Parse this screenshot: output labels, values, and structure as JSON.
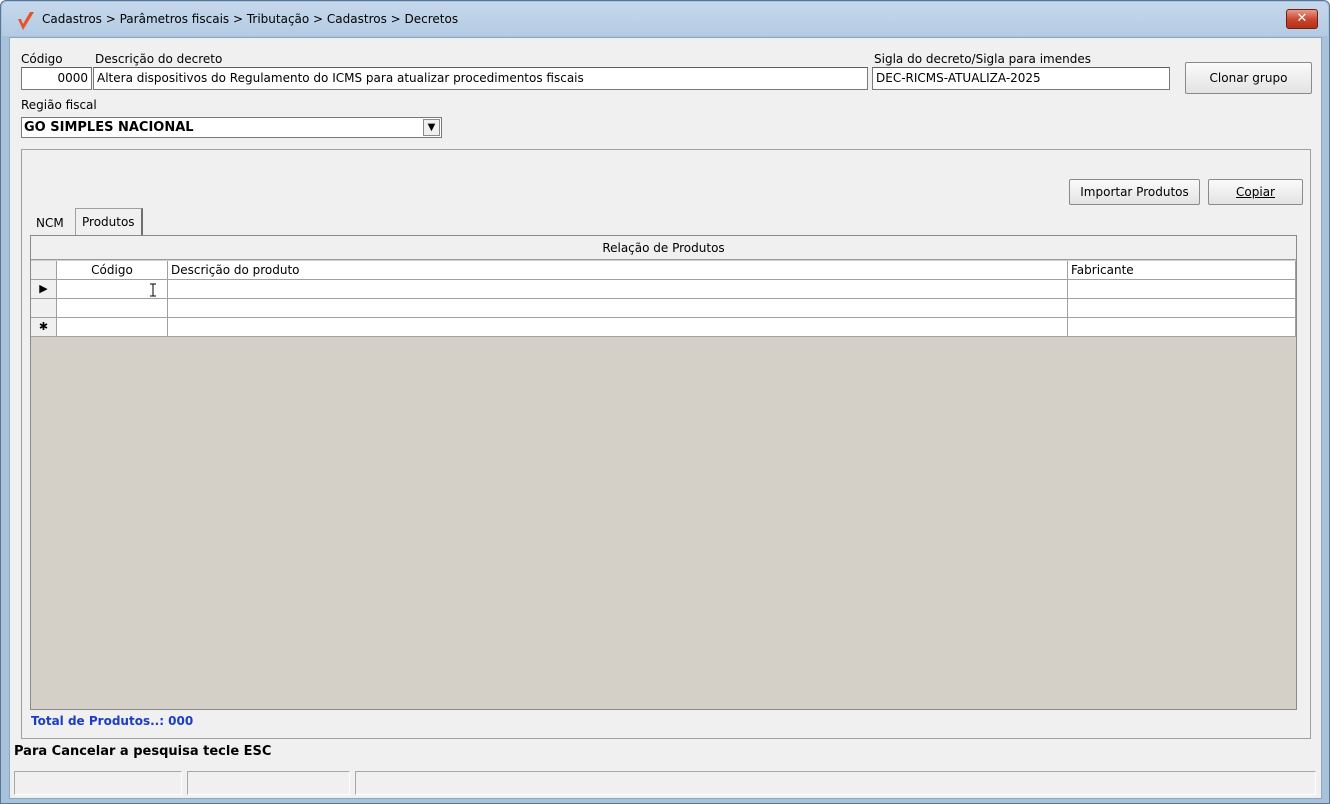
{
  "window": {
    "title": "Cadastros > Parâmetros fiscais > Tributação > Cadastros > Decretos",
    "close_symbol": "✕"
  },
  "form": {
    "codigo_label": "Código",
    "codigo_value": "0000",
    "descricao_label": "Descrição do decreto",
    "descricao_value": "Altera dispositivos do Regulamento do ICMS para atualizar procedimentos fiscais",
    "sigla_label": "Sigla do decreto/Sigla para imendes",
    "sigla_value": "DEC-RICMS-ATUALIZA-2025",
    "clonar_label": "Clonar grupo",
    "regiao_label": "Região fiscal",
    "regiao_value": "GO SIMPLES NACIONAL"
  },
  "toolbar": {
    "importar_label": "Importar Produtos",
    "copiar_label": "Copiar"
  },
  "tabs": [
    {
      "label": "NCM",
      "active": false
    },
    {
      "label": "Produtos",
      "active": true
    }
  ],
  "grid": {
    "caption": "Relação de Produtos",
    "columns": [
      "Código",
      "Descrição do produto",
      "Fabricante"
    ],
    "rows": [
      {
        "indicator": "▶",
        "codigo": "",
        "descricao": "",
        "fabricante": ""
      },
      {
        "indicator": "",
        "codigo": "",
        "descricao": "",
        "fabricante": ""
      },
      {
        "indicator": "✱",
        "codigo": "",
        "descricao": "",
        "fabricante": ""
      }
    ]
  },
  "footer": {
    "total_label": "Total de Produtos..: 000",
    "hint": "Para Cancelar a pesquisa tecle ESC"
  },
  "colors": {
    "total_text": "#1a3cc8",
    "grid_background": "#d4d0c8",
    "title_bar": "#b4cbe3"
  }
}
